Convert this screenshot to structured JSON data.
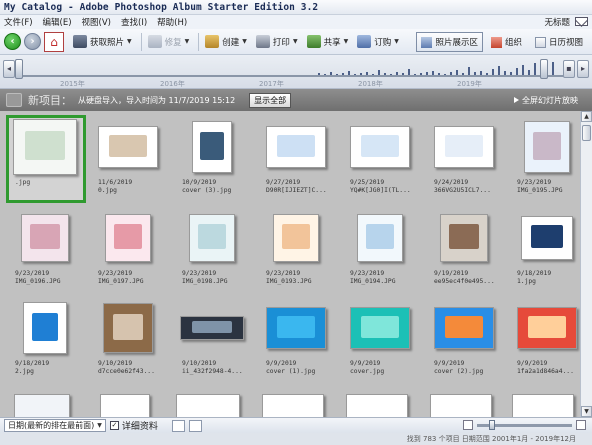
{
  "window": {
    "title": "My Catalog - Adobe Photoshop Album Starter Edition 3.2"
  },
  "menu": {
    "items": [
      "文件(F)",
      "编辑(E)",
      "视图(V)",
      "查找(I)",
      "帮助(H)"
    ],
    "user": "无标题"
  },
  "toolbar": {
    "get_photos": "获取照片",
    "fix": "修复",
    "create": "创建",
    "print": "打印",
    "share": "共享",
    "order": "订购",
    "view_photo_well": "照片展示区",
    "view_organize": "组织",
    "view_calendar": "日历视图"
  },
  "timeline": {
    "years": [
      "2015年",
      "2016年",
      "2017年",
      "2018年",
      "2019年"
    ]
  },
  "header": {
    "new_item": "新项目：",
    "import_text": "从硬盘导入，导入时间为  11/7/2019 15:12",
    "show_all": "显示全部",
    "slideshow": "全屏幻灯片放映"
  },
  "photos": [
    {
      "date": "",
      "name": ".jpg",
      "selected": true
    },
    {
      "date": "11/6/2019",
      "name": "0.jpg"
    },
    {
      "date": "10/9/2019",
      "name": "cover (3).jpg"
    },
    {
      "date": "9/27/2019",
      "name": "D90R[IJIEZT]C..."
    },
    {
      "date": "9/25/2019",
      "name": "YQ#K[JG0]I(TL..."
    },
    {
      "date": "9/24/2019",
      "name": "366VG2U5ICL7..."
    },
    {
      "date": "9/23/2019",
      "name": "IMG_0195.JPG"
    },
    {
      "date": "9/23/2019",
      "name": "IMG_0196.JPG"
    },
    {
      "date": "9/23/2019",
      "name": "IMG_0197.JPG"
    },
    {
      "date": "9/23/2019",
      "name": "IMG_0198.JPG"
    },
    {
      "date": "9/23/2019",
      "name": "IMG_0193.JPG"
    },
    {
      "date": "9/23/2019",
      "name": "IMG_0194.JPG"
    },
    {
      "date": "9/19/2019",
      "name": "ee95ec4f0e495..."
    },
    {
      "date": "9/18/2019",
      "name": "1.jpg"
    },
    {
      "date": "9/18/2019",
      "name": "2.jpg"
    },
    {
      "date": "9/10/2019",
      "name": "d7cce0e62f43..."
    },
    {
      "date": "9/10/2019",
      "name": "ii_432f2948-4..."
    },
    {
      "date": "9/9/2019",
      "name": "cover (1).jpg"
    },
    {
      "date": "9/9/2019",
      "name": "cover.jpg"
    },
    {
      "date": "9/9/2019",
      "name": "cover (2).jpg"
    },
    {
      "date": "9/9/2019",
      "name": "1fa2a1d846a4..."
    }
  ],
  "bottom": {
    "sort": "日期(最新的排在最前面)",
    "details": "详细资料"
  },
  "status": {
    "text": "找到 783 个项目  日期范围  2001年1月 - 2019年12月"
  }
}
